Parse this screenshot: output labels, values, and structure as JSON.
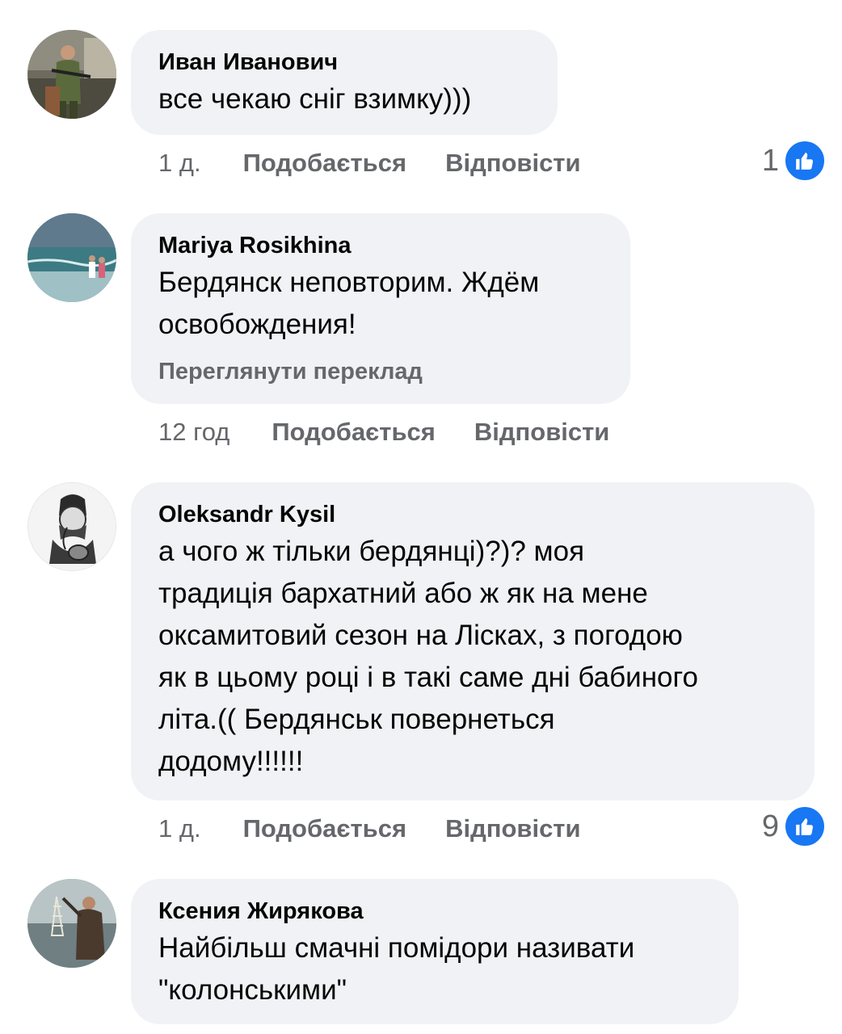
{
  "comments": [
    {
      "author": "Иван Иванович",
      "text": "все чекаю сніг взимку)))",
      "time": "1 д.",
      "like_label": "Подобається",
      "reply_label": "Відповісти",
      "reactions": "1",
      "avatar_icon": "soldier-photo"
    },
    {
      "author": "Mariya Rosikhina",
      "text": "Бердянск неповторим. Ждём\nосвобождения!",
      "translate_label": "Переглянути переклад",
      "time": "12 год",
      "like_label": "Подобається",
      "reply_label": "Відповісти",
      "avatar_icon": "sea-photo"
    },
    {
      "author": "Oleksandr Kysil",
      "text": "а чого ж тільки бердянці)?)? моя\nтрадиція бархатний або ж як на мене\nоксамитовий сезон на Лісках, з погодою\nяк в цьому році і в такі саме дні бабиного\nліта.(( Бердянськ повернеться\nдодому!!!!!!",
      "time": "1 д.",
      "like_label": "Подобається",
      "reply_label": "Відповісти",
      "reactions": "9",
      "avatar_icon": "cossack-drawing"
    },
    {
      "author": "Ксения Жирякова",
      "text": "Найбільш смачні помідори називати\n\"колонськими\"",
      "avatar_icon": "fisherman-photo"
    }
  ],
  "colors": {
    "bubble": "#f0f2f5",
    "secondary_text": "#65676b",
    "like_blue": "#1877f2"
  }
}
